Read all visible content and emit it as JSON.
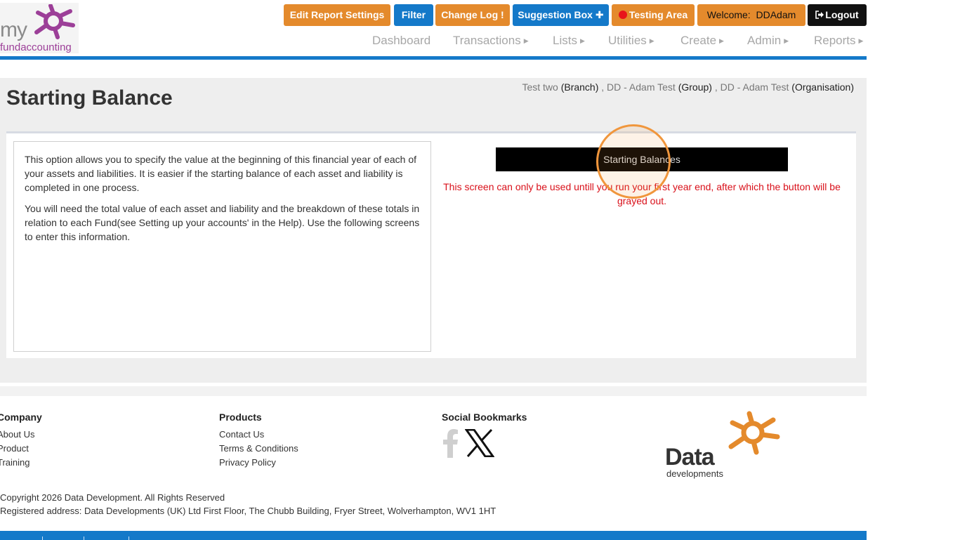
{
  "logo": {
    "prefix": "my",
    "suffix": "fundaccounting"
  },
  "toolbar": {
    "edit_report_settings": "Edit Report Settings",
    "filter": "Filter",
    "change_log": "Change Log",
    "change_log_mark": "!",
    "suggestion_box": "Suggestion Box",
    "suggestion_mark": "✚",
    "testing_area": "Testing Area",
    "welcome_label": "Welcome:",
    "welcome_user": "DDAdam",
    "logout": "Logout"
  },
  "nav": {
    "dashboard": "Dashboard",
    "transactions": "Transactions",
    "lists": "Lists",
    "utilities": "Utilities",
    "create": "Create",
    "admin": "Admin",
    "reports": "Reports"
  },
  "page": {
    "title": "Starting Balance",
    "context": {
      "branch_name": "Test two",
      "branch_label": "(Branch)",
      "group_name": "DD - Adam Test",
      "group_label": "(Group)",
      "org_name": "DD - Adam Test",
      "org_label": "(Organisation)",
      "sep": ","
    },
    "info_p1": "This option allows you to specify the value at the beginning of this financial year of each of your assets and liabilities. It is easier if the starting balance of each asset and liability is completed in one process.",
    "info_p2": "You will need the total value of each asset and liability and the breakdown of these totals in relation to each Fund(see Setting up your accounts' in the Help). Use the following screens to enter this information.",
    "starting_balances_button": "Starting Balances",
    "warning": "This screen can only be used untill you run your first year end, after which the button will be grayed out."
  },
  "footer": {
    "company": {
      "heading": "Company",
      "links": [
        "About Us",
        "Product",
        "Training"
      ]
    },
    "products": {
      "heading": "Products",
      "links": [
        "Contact Us",
        "Terms & Conditions",
        "Privacy Policy"
      ]
    },
    "social": {
      "heading": "Social Bookmarks"
    },
    "copyright": "Copyright 2026 Data Development. All Rights Reserved",
    "address": "Registered address: Data Developments (UK) Ltd First Floor, The Chubb Building, Fryer Street, Wolverhampton, WV1 1HT",
    "dd_logo": {
      "word": "Data",
      "sub": "developments"
    }
  },
  "colors": {
    "orange": "#e48a2c",
    "blue": "#1479c9",
    "warning_red": "#d9101a",
    "purple": "#9c3f98"
  }
}
